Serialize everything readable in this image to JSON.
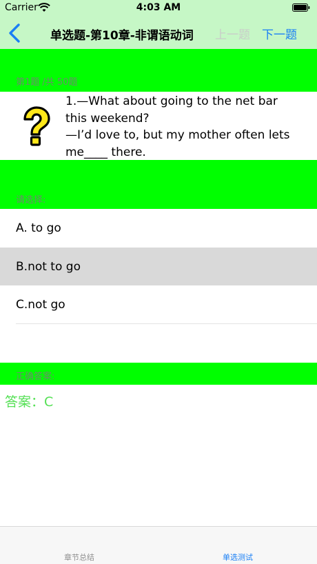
{
  "status_bar": {
    "carrier": "Carrier",
    "time": "4:03 AM"
  },
  "nav": {
    "title": "单选题-第10章-非谓语动词",
    "prev_label": "上一题",
    "next_label": "下一题"
  },
  "question": {
    "counter": "第1题 /共 50题",
    "text": "1.—What about going to the net bar\nthis weekend?\n—I’d love to, but my mother often lets\nme____ there."
  },
  "options": {
    "prompt": "请选择:",
    "items": [
      {
        "label": "A. to go"
      },
      {
        "label": "B.not to go"
      },
      {
        "label": "C.not go"
      }
    ],
    "selected_index": 1
  },
  "answer": {
    "heading": "正确答案:",
    "text": "答案：C"
  },
  "tabs": {
    "items": [
      {
        "label": "章节总结"
      },
      {
        "label": "单选测试"
      }
    ],
    "active_index": 1
  },
  "colors": {
    "status_bg": "#c6f7c6",
    "section_green": "#00ff00",
    "accent_blue": "#1a7ff5",
    "answer_green": "#55e055",
    "selected_row": "#d9d9d9"
  },
  "icons": [
    "wifi-icon",
    "battery-icon",
    "back-chevron-icon",
    "question-mark-icon"
  ]
}
